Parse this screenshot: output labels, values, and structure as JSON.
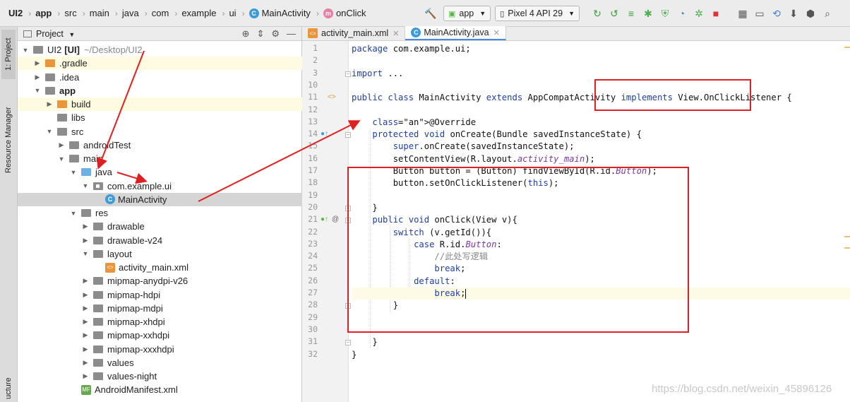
{
  "breadcrumbs": [
    {
      "label": "UI2",
      "bold": true
    },
    {
      "label": "app",
      "bold": true
    },
    {
      "label": "src"
    },
    {
      "label": "main"
    },
    {
      "label": "java"
    },
    {
      "label": "com"
    },
    {
      "label": "example"
    },
    {
      "label": "ui"
    },
    {
      "label": "MainActivity",
      "icon": "class-icon",
      "icon_letter": "C"
    },
    {
      "label": "onClick",
      "icon": "method-icon",
      "icon_letter": "m"
    }
  ],
  "toolbar": {
    "run_config": "app",
    "device": "Pixel 4 API 29"
  },
  "left_strip": {
    "project_tab": "1: Project",
    "resource_manager_tab": "Resource Manager",
    "structure_tab": "ucture"
  },
  "project_panel": {
    "title": "Project",
    "tree": [
      {
        "label": "UI2",
        "bold_suffix": "[UI]",
        "path": "~/Desktop/UI2",
        "depth": 0,
        "expanded": true,
        "icon": "module-folder"
      },
      {
        "label": ".gradle",
        "depth": 1,
        "expanded": false,
        "icon": "folder-orange"
      },
      {
        "label": ".idea",
        "depth": 1,
        "expanded": false,
        "icon": "folder-grey"
      },
      {
        "label": "app",
        "depth": 1,
        "expanded": true,
        "icon": "module-folder",
        "bold": true
      },
      {
        "label": "build",
        "depth": 2,
        "expanded": false,
        "icon": "folder-orange"
      },
      {
        "label": "libs",
        "depth": 2,
        "expanded": null,
        "icon": "folder-grey"
      },
      {
        "label": "src",
        "depth": 2,
        "expanded": true,
        "icon": "folder-grey"
      },
      {
        "label": "androidTest",
        "depth": 3,
        "expanded": false,
        "icon": "folder-grey"
      },
      {
        "label": "main",
        "depth": 3,
        "expanded": true,
        "icon": "folder-grey"
      },
      {
        "label": "java",
        "depth": 4,
        "expanded": true,
        "icon": "folder-blue"
      },
      {
        "label": "com.example.ui",
        "depth": 5,
        "expanded": true,
        "icon": "package"
      },
      {
        "label": "MainActivity",
        "depth": 6,
        "expanded": null,
        "icon": "class-file",
        "selected": true
      },
      {
        "label": "res",
        "depth": 4,
        "expanded": true,
        "icon": "folder-grey"
      },
      {
        "label": "drawable",
        "depth": 5,
        "expanded": false,
        "icon": "folder-grey"
      },
      {
        "label": "drawable-v24",
        "depth": 5,
        "expanded": false,
        "icon": "folder-grey"
      },
      {
        "label": "layout",
        "depth": 5,
        "expanded": true,
        "icon": "folder-grey"
      },
      {
        "label": "activity_main.xml",
        "depth": 6,
        "expanded": null,
        "icon": "xml-file"
      },
      {
        "label": "mipmap-anydpi-v26",
        "depth": 5,
        "expanded": false,
        "icon": "folder-grey"
      },
      {
        "label": "mipmap-hdpi",
        "depth": 5,
        "expanded": false,
        "icon": "folder-grey"
      },
      {
        "label": "mipmap-mdpi",
        "depth": 5,
        "expanded": false,
        "icon": "folder-grey"
      },
      {
        "label": "mipmap-xhdpi",
        "depth": 5,
        "expanded": false,
        "icon": "folder-grey"
      },
      {
        "label": "mipmap-xxhdpi",
        "depth": 5,
        "expanded": false,
        "icon": "folder-grey"
      },
      {
        "label": "mipmap-xxxhdpi",
        "depth": 5,
        "expanded": false,
        "icon": "folder-grey"
      },
      {
        "label": "values",
        "depth": 5,
        "expanded": false,
        "icon": "folder-grey"
      },
      {
        "label": "values-night",
        "depth": 5,
        "expanded": false,
        "icon": "folder-grey"
      },
      {
        "label": "AndroidManifest.xml",
        "depth": 4,
        "expanded": null,
        "icon": "manifest-file"
      }
    ]
  },
  "editor": {
    "tabs": [
      {
        "label": "activity_main.xml",
        "icon": "xml-file-icon",
        "active": false
      },
      {
        "label": "MainActivity.java",
        "icon": "class-icon",
        "active": true
      }
    ],
    "line_numbers": [
      "1",
      "2",
      "3",
      "10",
      "11",
      "12",
      "13",
      "14",
      "15",
      "16",
      "17",
      "18",
      "19",
      "20",
      "21",
      "22",
      "23",
      "24",
      "25",
      "26",
      "27",
      "28",
      "29",
      "30",
      "31",
      "32"
    ],
    "code_lines": [
      "package com.example.ui;",
      "",
      "import ...",
      "",
      "public class MainActivity extends AppCompatActivity implements View.OnClickListener {",
      "",
      "    @Override",
      "    protected void onCreate(Bundle savedInstanceState) {",
      "        super.onCreate(savedInstanceState);",
      "        setContentView(R.layout.activity_main);",
      "        Button button = (Button) findViewById(R.id.Button);",
      "        button.setOnClickListener(this);",
      "",
      "    }",
      "    public void onClick(View v){",
      "        switch (v.getId()){",
      "            case R.id.Button:",
      "                //此处写逻辑",
      "                break;",
      "            default:",
      "                break;",
      "        }",
      "",
      "",
      "    }",
      "}"
    ]
  },
  "watermark": "https://blog.csdn.net/weixin_45896126",
  "colors": {
    "annotation_box": "#e02020",
    "keyword": "#1f3f9f",
    "annotation": "#8a8a00",
    "selection": "#d5d5d5"
  }
}
